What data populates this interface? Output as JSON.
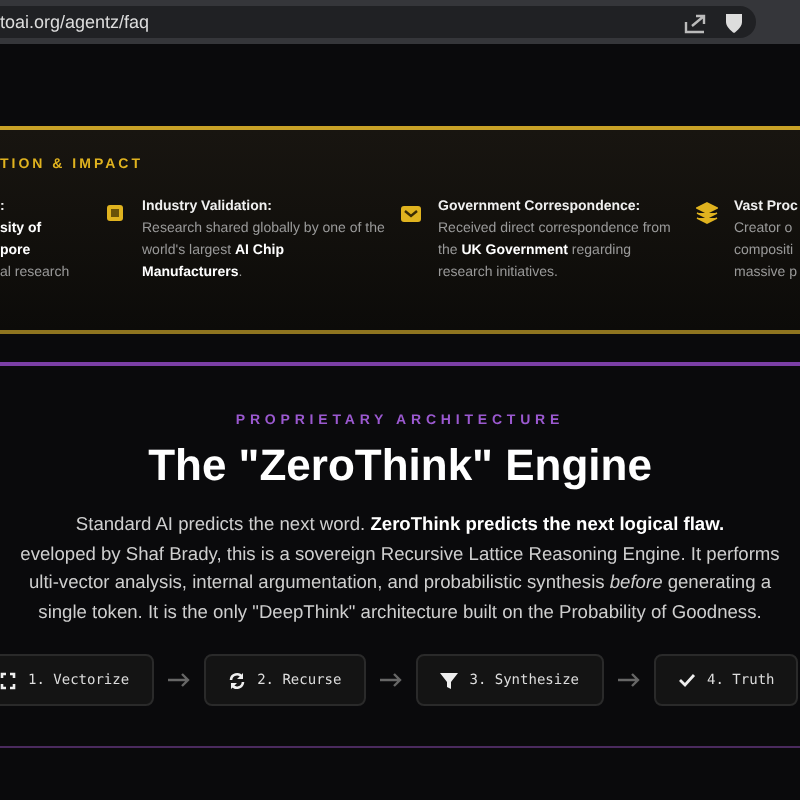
{
  "browser": {
    "url": "toai.org/agentz/faq"
  },
  "impact": {
    "heading": "TION & IMPACT",
    "items": [
      {
        "kind": "none",
        "title": ":",
        "lines": [
          "sity of",
          "pore",
          "al research"
        ]
      },
      {
        "kind": "chip",
        "title": "Industry Validation:",
        "text": "Research shared globally by one of the world's largest **AI Chip Manufacturers**."
      },
      {
        "kind": "mail",
        "title": "Government Correspondence:",
        "text": "Received direct correspondence from the **UK Government** regarding research initiatives."
      },
      {
        "kind": "layers",
        "title": "Vast Proc",
        "lines": [
          "Creator o",
          "compositi",
          "massive p"
        ]
      }
    ]
  },
  "architecture": {
    "eyebrow": "PROPRIETARY ARCHITECTURE",
    "title": "The \"ZeroThink\" Engine",
    "lines": [
      "Standard AI predicts the next word. **ZeroThink predicts the next logical flaw.**",
      "eveloped by Shaf Brady, this is a sovereign Recursive Lattice Reasoning Engine. It performs",
      "ulti-vector analysis, internal argumentation, and probabilistic synthesis *before* generating a",
      "single token. It is the only \"DeepThink\" architecture built on the Probability of Goodness."
    ],
    "steps": [
      {
        "kind": "expand",
        "label": "1. Vectorize"
      },
      {
        "kind": "refresh",
        "label": "2. Recurse"
      },
      {
        "kind": "filter",
        "label": "3. Synthesize"
      },
      {
        "kind": "check",
        "label": "4. Truth"
      }
    ]
  }
}
